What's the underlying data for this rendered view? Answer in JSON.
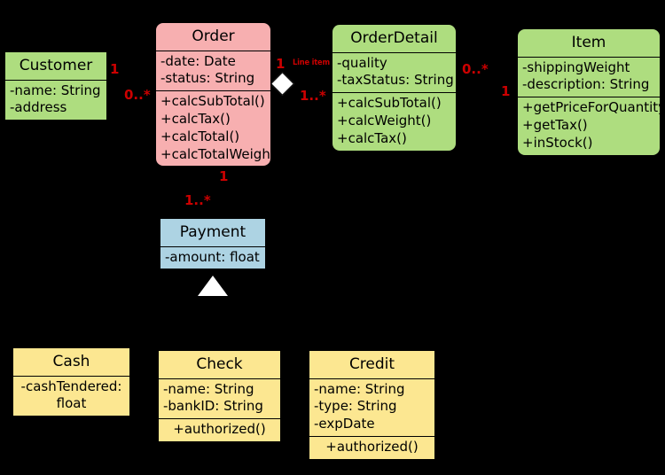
{
  "diagram": {
    "type": "uml-class-diagram",
    "background_color": "#000000",
    "text_color": "#000000",
    "multiplicity_color": "#CC0000"
  },
  "classes": [
    {
      "id": "customer",
      "name": "Customer",
      "fill": "#AEDD7F",
      "attributes": [
        "-name: String",
        "-address"
      ],
      "operations": []
    },
    {
      "id": "order",
      "name": "Order",
      "fill": "#F7AFB0",
      "attributes": [
        "-date: Date",
        "-status: String"
      ],
      "operations": [
        "+calcSubTotal()",
        "+calcTax()",
        "+calcTotal()",
        "+calcTotalWeight()"
      ]
    },
    {
      "id": "orderdetail",
      "name": "OrderDetail",
      "fill": "#AEDD7F",
      "attributes": [
        "-quality",
        "-taxStatus: String"
      ],
      "operations": [
        "+calcSubTotal()",
        "+calcWeight()",
        "+calcTax()"
      ]
    },
    {
      "id": "item",
      "name": "Item",
      "fill": "#AEDD7F",
      "attributes": [
        "-shippingWeight",
        "-description: String"
      ],
      "operations": [
        "+getPriceForQuantity()",
        "+getTax()",
        "+inStock()"
      ]
    },
    {
      "id": "payment",
      "name": "Payment",
      "fill": "#ADD3E3",
      "attributes": [
        "-amount: float"
      ],
      "operations": []
    },
    {
      "id": "cash",
      "name": "Cash",
      "fill": "#FCE791",
      "attributes": [
        "-cashTendered: float"
      ],
      "operations": []
    },
    {
      "id": "check",
      "name": "Check",
      "fill": "#FCE791",
      "attributes": [
        "-name: String",
        "-bankID: String"
      ],
      "operations": [
        "+authorized()"
      ]
    },
    {
      "id": "credit",
      "name": "Credit",
      "fill": "#FCE791",
      "attributes": [
        "-name: String",
        "-type: String",
        "-expDate"
      ],
      "operations": [
        "+authorized()"
      ]
    }
  ],
  "multiplicities": {
    "customer_to_order": "1",
    "order_to_customer": "0..*",
    "order_to_orderdetail": "1",
    "orderdetail_to_order": "1..*",
    "orderdetail_to_item": "0..*",
    "item_to_orderdetail": "1",
    "order_to_payment": "1",
    "payment_to_order": "1..*"
  },
  "association_labels": {
    "line_item": "Line item"
  }
}
